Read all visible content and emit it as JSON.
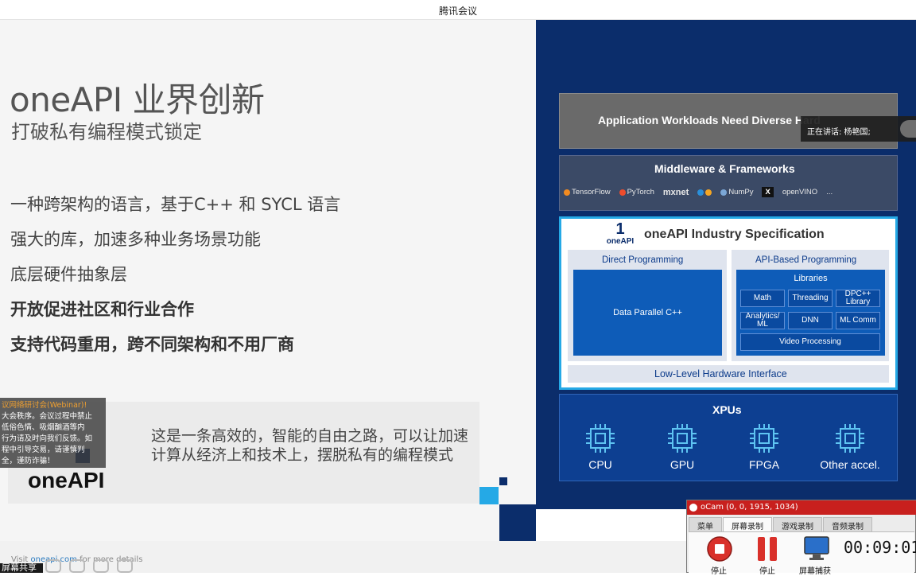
{
  "window": {
    "title": "腾讯会议"
  },
  "slide": {
    "title": "oneAPI 业界创新",
    "subtitle": "打破私有编程模式锁定",
    "bullets": [
      {
        "text": "一种跨架构的语言，基于C++ 和 SYCL 语言",
        "bold": false
      },
      {
        "text": "强大的库，加速多种业务场景功能",
        "bold": false
      },
      {
        "text": "底层硬件抽象层",
        "bold": false
      },
      {
        "text": "开放促进社区和行业合作",
        "bold": true
      },
      {
        "text": "支持代码重用，跨不同架构和不用厂商",
        "bold": true
      }
    ],
    "quote": "这是一条高效的，智能的自由之路，可以让加速计算从经济上和技术上，摆脱私有的编程模式",
    "logo": "oneAPI",
    "visit_prefix": "Visit ",
    "visit_link": "oneapi.com",
    "visit_suffix": " for more details",
    "colors": {
      "navy": "#0b2d6b",
      "cyan": "#25a9e6",
      "blue": "#0e5cb8"
    }
  },
  "stack": {
    "app_layer": "Application Workloads Need Diverse Hard",
    "middleware_title": "Middleware & Frameworks",
    "frameworks": [
      "TensorFlow",
      "PyTorch",
      "mxnet",
      "",
      "NumPy",
      "",
      "openVINO",
      "..."
    ],
    "spec_logo_number": "1",
    "spec_logo_label": "oneAPI",
    "spec_title": "oneAPI Industry Specification",
    "direct_title": "Direct Programming",
    "direct_item": "Data Parallel C++",
    "api_title": "API-Based Programming",
    "libraries_title": "Libraries",
    "libraries": [
      "Math",
      "Threading",
      "DPC++ Library",
      "Analytics/ ML",
      "DNN",
      "ML Comm",
      "Video Processing"
    ],
    "low_level": "Low-Level Hardware Interface",
    "xpus_title": "XPUs",
    "xpus": [
      "CPU",
      "GPU",
      "FPGA",
      "Other accel."
    ]
  },
  "meeting": {
    "speaker": "正在讲话: 杨艳国;",
    "notice_title": "议网络研讨会(Webinar)!",
    "notice_lines": [
      "大会秩序。会议过程中禁止",
      "低俗色情、吸烟酗酒等内",
      "行为请及时向我们反馈。如",
      "程中引导交易，请谨慎判",
      "全，谨防诈骗！"
    ],
    "share_label": "屏幕共享"
  },
  "ocam": {
    "title": "oCam (0, 0, 1915, 1034)",
    "tabs": [
      "菜单",
      "屏幕录制",
      "游戏录制",
      "音频录制"
    ],
    "active_tab": "屏幕录制",
    "buttons": [
      "停止",
      "停止",
      "屏幕捕获"
    ],
    "time": "00:09:01"
  }
}
